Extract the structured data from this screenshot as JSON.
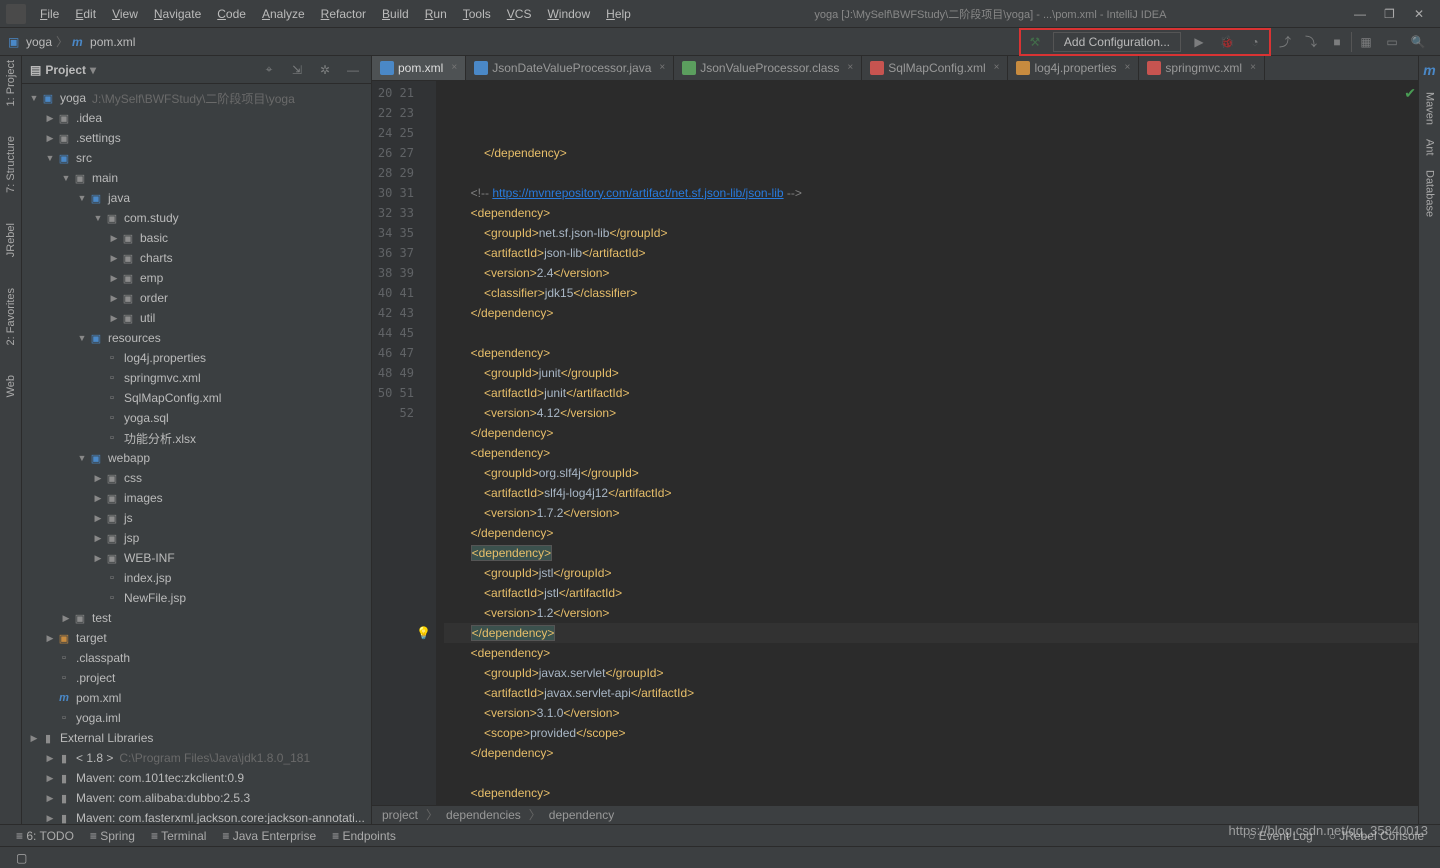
{
  "title": "yoga [J:\\MySelf\\BWFStudy\\二阶段项目\\yoga] - ...\\pom.xml - IntelliJ IDEA",
  "menu": [
    "File",
    "Edit",
    "View",
    "Navigate",
    "Code",
    "Analyze",
    "Refactor",
    "Build",
    "Run",
    "Tools",
    "VCS",
    "Window",
    "Help"
  ],
  "breadcrumb": {
    "project": "yoga",
    "file": "pom.xml"
  },
  "run_config_label": "Add Configuration...",
  "project_view": {
    "title": "Project"
  },
  "tree": [
    {
      "d": 0,
      "a": "▼",
      "i": "folder-blue",
      "t": "yoga",
      "h": "J:\\MySelf\\BWFStudy\\二阶段项目\\yoga"
    },
    {
      "d": 1,
      "a": "▶",
      "i": "folder",
      "t": ".idea"
    },
    {
      "d": 1,
      "a": "▶",
      "i": "folder",
      "t": ".settings"
    },
    {
      "d": 1,
      "a": "▼",
      "i": "folder-blue",
      "t": "src"
    },
    {
      "d": 2,
      "a": "▼",
      "i": "folder",
      "t": "main"
    },
    {
      "d": 3,
      "a": "▼",
      "i": "folder-blue",
      "t": "java"
    },
    {
      "d": 4,
      "a": "▼",
      "i": "folder",
      "t": "com.study"
    },
    {
      "d": 5,
      "a": "▶",
      "i": "folder",
      "t": "basic"
    },
    {
      "d": 5,
      "a": "▶",
      "i": "folder",
      "t": "charts"
    },
    {
      "d": 5,
      "a": "▶",
      "i": "folder",
      "t": "emp"
    },
    {
      "d": 5,
      "a": "▶",
      "i": "folder",
      "t": "order"
    },
    {
      "d": 5,
      "a": "▶",
      "i": "folder",
      "t": "util"
    },
    {
      "d": 3,
      "a": "▼",
      "i": "folder-blue",
      "t": "resources"
    },
    {
      "d": 4,
      "a": "",
      "i": "file",
      "t": "log4j.properties"
    },
    {
      "d": 4,
      "a": "",
      "i": "file",
      "t": "springmvc.xml"
    },
    {
      "d": 4,
      "a": "",
      "i": "file",
      "t": "SqlMapConfig.xml"
    },
    {
      "d": 4,
      "a": "",
      "i": "file",
      "t": "yoga.sql"
    },
    {
      "d": 4,
      "a": "",
      "i": "file",
      "t": "功能分析.xlsx"
    },
    {
      "d": 3,
      "a": "▼",
      "i": "folder-blue",
      "t": "webapp"
    },
    {
      "d": 4,
      "a": "▶",
      "i": "folder",
      "t": "css"
    },
    {
      "d": 4,
      "a": "▶",
      "i": "folder",
      "t": "images"
    },
    {
      "d": 4,
      "a": "▶",
      "i": "folder",
      "t": "js"
    },
    {
      "d": 4,
      "a": "▶",
      "i": "folder",
      "t": "jsp"
    },
    {
      "d": 4,
      "a": "▶",
      "i": "folder",
      "t": "WEB-INF"
    },
    {
      "d": 4,
      "a": "",
      "i": "file",
      "t": "index.jsp"
    },
    {
      "d": 4,
      "a": "",
      "i": "file",
      "t": "NewFile.jsp"
    },
    {
      "d": 2,
      "a": "▶",
      "i": "folder",
      "t": "test"
    },
    {
      "d": 1,
      "a": "▶",
      "i": "folder-orange",
      "t": "target"
    },
    {
      "d": 1,
      "a": "",
      "i": "file",
      "t": ".classpath"
    },
    {
      "d": 1,
      "a": "",
      "i": "file",
      "t": ".project"
    },
    {
      "d": 1,
      "a": "",
      "i": "file-m",
      "t": "pom.xml"
    },
    {
      "d": 1,
      "a": "",
      "i": "file",
      "t": "yoga.iml"
    },
    {
      "d": 0,
      "a": "▶",
      "i": "lib",
      "t": "External Libraries"
    },
    {
      "d": 1,
      "a": "▶",
      "i": "lib",
      "t": "< 1.8 >",
      "h": "C:\\Program Files\\Java\\jdk1.8.0_181"
    },
    {
      "d": 1,
      "a": "▶",
      "i": "lib",
      "t": "Maven: com.101tec:zkclient:0.9"
    },
    {
      "d": 1,
      "a": "▶",
      "i": "lib",
      "t": "Maven: com.alibaba:dubbo:2.5.3"
    },
    {
      "d": 1,
      "a": "▶",
      "i": "lib",
      "t": "Maven: com.fasterxml.jackson.core:jackson-annotati..."
    }
  ],
  "tabs": [
    {
      "label": "pom.xml",
      "active": true,
      "color": "#4a88c7"
    },
    {
      "label": "JsonDateValueProcessor.java",
      "color": "#4a88c7"
    },
    {
      "label": "JsonValueProcessor.class",
      "color": "#5b9e5e"
    },
    {
      "label": "SqlMapConfig.xml",
      "color": "#c75450"
    },
    {
      "label": "log4j.properties",
      "color": "#c78b3f"
    },
    {
      "label": "springmvc.xml",
      "color": "#c75450"
    }
  ],
  "line_start": 20,
  "line_end": 52,
  "code_lines": [
    "            </dependency>",
    "",
    "        <!-- https://mvnrepository.com/artifact/net.sf.json-lib/json-lib -->",
    "        <dependency>",
    "            <groupId>net.sf.json-lib</groupId>",
    "            <artifactId>json-lib</artifactId>",
    "            <version>2.4</version>",
    "            <classifier>jdk15</classifier>",
    "        </dependency>",
    "",
    "        <dependency>",
    "            <groupId>junit</groupId>",
    "            <artifactId>junit</artifactId>",
    "            <version>4.12</version>",
    "        </dependency>",
    "        <dependency>",
    "            <groupId>org.slf4j</groupId>",
    "            <artifactId>slf4j-log4j12</artifactId>",
    "            <version>1.7.2</version>",
    "        </dependency>",
    "        <dependency>",
    "            <groupId>jstl</groupId>",
    "            <artifactId>jstl</artifactId>",
    "            <version>1.2</version>",
    "        </dependency>",
    "        <dependency>",
    "            <groupId>javax.servlet</groupId>",
    "            <artifactId>javax.servlet-api</artifactId>",
    "            <version>3.1.0</version>",
    "            <scope>provided</scope>",
    "        </dependency>",
    "",
    "        <dependency>"
  ],
  "editor_crumbs": [
    "project",
    "dependencies",
    "dependency"
  ],
  "left_tools": [
    "1: Project",
    "7: Structure",
    "JRebel",
    "2: Favorites",
    "Web"
  ],
  "right_tools": [
    "Maven",
    "Ant",
    "Database"
  ],
  "bottom_tools": [
    "6: TODO",
    "Spring",
    "Terminal",
    "Java Enterprise",
    "Endpoints"
  ],
  "status_right": [
    "Event Log",
    "JRebel Console"
  ],
  "watermark": "https://blog.csdn.net/qq_35840013"
}
